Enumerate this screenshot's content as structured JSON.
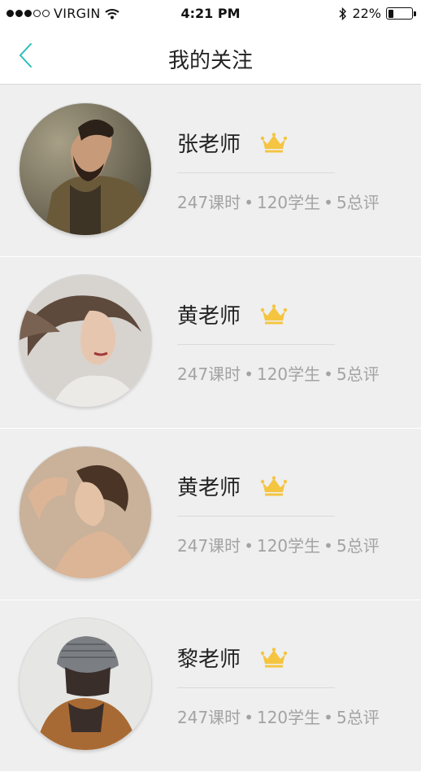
{
  "status_bar": {
    "carrier": "VIRGIN",
    "time": "4:21 PM",
    "battery": "22%",
    "battery_level": 0.22,
    "icons": [
      "signal-dots-icon",
      "wifi-icon",
      "bluetooth-icon",
      "battery-icon"
    ]
  },
  "nav": {
    "title": "我的关注",
    "back_icon": "chevron-left-icon",
    "accent_color": "#2bbdbd"
  },
  "teachers": [
    {
      "name": "张老师",
      "avatar": "bearded-man",
      "badge_icon": "crown-icon",
      "lessons": "247课时",
      "students": "120学生",
      "reviews": "5总评"
    },
    {
      "name": "黄老师",
      "avatar": "windswept-hair-woman",
      "badge_icon": "crown-icon",
      "lessons": "247课时",
      "students": "120学生",
      "reviews": "5总评"
    },
    {
      "name": "黄老师",
      "avatar": "profile-woman",
      "badge_icon": "crown-icon",
      "lessons": "247课时",
      "students": "120学生",
      "reviews": "5总评"
    },
    {
      "name": "黎老师",
      "avatar": "beanie-person",
      "badge_icon": "crown-icon",
      "lessons": "247课时",
      "students": "120学生",
      "reviews": "5总评"
    }
  ],
  "stat_separator": "•",
  "colors": {
    "crown": "#f5c542",
    "stats_text": "#a3a3a3",
    "background": "#efefef"
  }
}
